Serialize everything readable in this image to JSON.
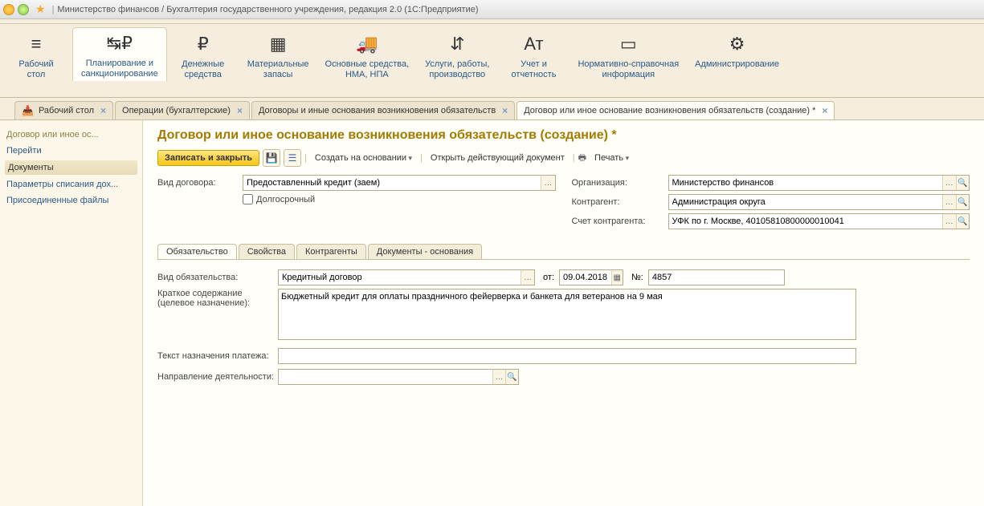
{
  "titlebar": {
    "title": "Министерство финансов / Бухгалтерия государственного учреждения, редакция 2.0  (1С:Предприятие)"
  },
  "sections": [
    {
      "label": "Рабочий\nстол",
      "icon": "≡"
    },
    {
      "label": "Планирование и\nсанкционирование",
      "icon": "↹₽"
    },
    {
      "label": "Денежные\nсредства",
      "icon": "₽"
    },
    {
      "label": "Материальные\nзапасы",
      "icon": "▦"
    },
    {
      "label": "Основные средства,\nНМА, НПА",
      "icon": "🚚"
    },
    {
      "label": "Услуги, работы,\nпроизводство",
      "icon": "⇵"
    },
    {
      "label": "Учет и\nотчетность",
      "icon": "Ат"
    },
    {
      "label": "Нормативно-справочная\nинформация",
      "icon": "▭"
    },
    {
      "label": "Администрирование",
      "icon": "⚙"
    }
  ],
  "tabs": [
    {
      "label": "Рабочий стол",
      "icon": "🖥"
    },
    {
      "label": "Операции (бухгалтерские)"
    },
    {
      "label": "Договоры и иные основания возникновения обязательств"
    },
    {
      "label": "Договор или иное основание возникновения обязательств (создание) *"
    }
  ],
  "leftpanel": {
    "title": "Договор или иное ос...",
    "items": [
      "Перейти",
      "Документы",
      "Параметры списания дох...",
      "Присоединенные файлы"
    ]
  },
  "page": {
    "title": "Договор или иное основание возникновения обязательств (создание) *",
    "toolbar": {
      "save_close": "Записать и закрыть",
      "create_based": "Создать на основании",
      "open_doc": "Открыть действующий документ",
      "print": "Печать"
    },
    "fields": {
      "vid_dogovora_lbl": "Вид договора:",
      "vid_dogovora": "Предоставленный кредит (заем)",
      "dolgosroch": "Долгосрочный",
      "org_lbl": "Организация:",
      "org": "Министерство финансов",
      "kontr_lbl": "Контрагент:",
      "kontr": "Администрация округа",
      "schet_lbl": "Счет контрагента:",
      "schet": "УФК по г. Москве, 40105810800000010041"
    },
    "subtabs": [
      "Обязательство",
      "Свойства",
      "Контрагенты",
      "Документы - основания"
    ],
    "obligation": {
      "vid_ob_lbl": "Вид обязательства:",
      "vid_ob": "Кредитный договор",
      "ot_lbl": "от:",
      "ot": "09.04.2018",
      "num_lbl": "№:",
      "num": "4857",
      "kratk_lbl": "Краткое содержание\n(целевое назначение):",
      "kratk": "Бюджетный кредит для оплаты праздничного фейерверка и банкета для ветеранов на 9 мая",
      "text_lbl": "Текст назначения платежа:",
      "text": "",
      "napr_lbl": "Направление деятельности:",
      "napr": ""
    }
  }
}
